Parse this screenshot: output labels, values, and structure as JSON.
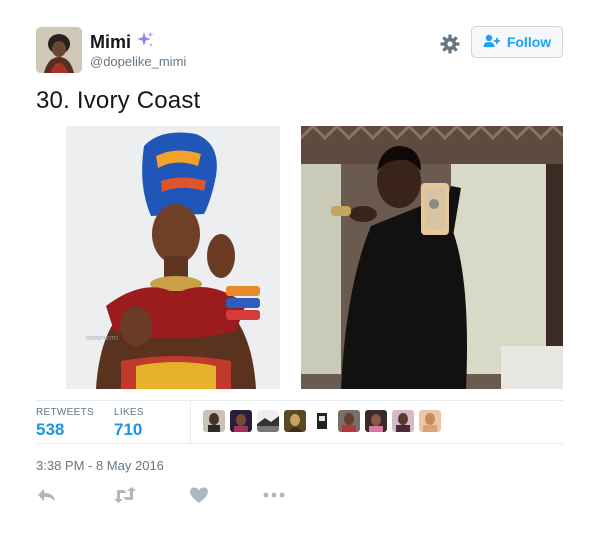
{
  "user": {
    "name": "Mimi",
    "name_emoji": "sparkles-icon",
    "handle": "@dopelike_mimi"
  },
  "header": {
    "follow_label": "Follow",
    "gear_icon": "gear-icon",
    "follow_icon": "add-user-icon"
  },
  "tweet": {
    "text": "30. Ivory Coast",
    "photos": [
      "photo-left",
      "photo-right"
    ],
    "watermark": "DOPEPHOTO"
  },
  "stats": {
    "retweets_label": "RETWEETS",
    "retweets_value": "538",
    "likes_label": "LIKES",
    "likes_value": "710"
  },
  "timestamp": "3:38 PM - 8 May 2016",
  "actions": [
    "reply-icon",
    "retweet-icon",
    "like-icon",
    "more-icon"
  ],
  "colors": {
    "link": "#1b95e0",
    "muted": "#657786",
    "text": "#14171a",
    "border": "#e6ecf0",
    "sparkle": "#9b7fe6"
  }
}
